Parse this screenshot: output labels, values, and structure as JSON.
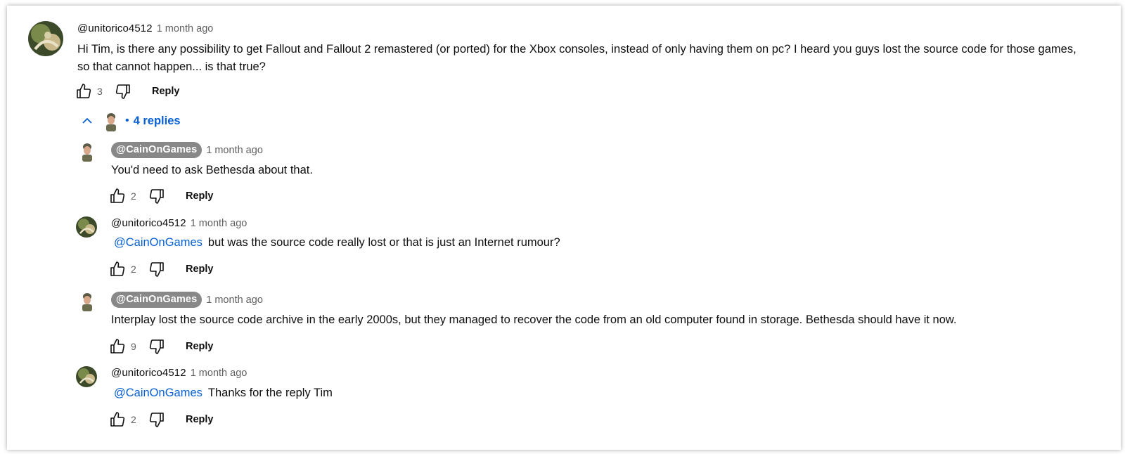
{
  "thread": {
    "top_comment": {
      "author": "@unitorico4512",
      "time": "1 month ago",
      "text": "Hi Tim, is there any possibility to get Fallout and Fallout 2 remastered (or ported) for the Xbox consoles, instead of only having them on pc? I heard you guys lost the source code for those games, so that cannot happen... is that true?",
      "likes": "3",
      "reply_label": "Reply"
    },
    "replies_toggle": {
      "count_label": "4 replies",
      "bullet": "•",
      "chevron_icon": "chevron-up-icon"
    },
    "replies": [
      {
        "author": "@CainOnGames",
        "time": "1 month ago",
        "text": "You'd need to ask Bethesda about that.",
        "mention": "",
        "likes": "2",
        "reply_label": "Reply",
        "creator": true
      },
      {
        "author": "@unitorico4512",
        "time": "1 month ago",
        "mention": "@CainOnGames",
        "text": "but was the source code really lost or that is just an Internet rumour?",
        "likes": "2",
        "reply_label": "Reply",
        "creator": false
      },
      {
        "author": "@CainOnGames",
        "time": "1 month ago",
        "mention": "",
        "text": "Interplay lost the source code archive in the early 2000s, but they managed to recover the code from an old computer found in storage. Bethesda should have it now.",
        "likes": "9",
        "reply_label": "Reply",
        "creator": true
      },
      {
        "author": "@unitorico4512",
        "time": "1 month ago",
        "mention": "@CainOnGames",
        "text": "Thanks for the reply Tim",
        "likes": "2",
        "reply_label": "Reply",
        "creator": false
      }
    ]
  },
  "colors": {
    "link_blue": "#065fd4",
    "creator_chip": "#888888",
    "meta_gray": "#606060"
  },
  "icons": [
    "like-icon",
    "dislike-icon",
    "chevron-up-icon",
    "avatar"
  ]
}
